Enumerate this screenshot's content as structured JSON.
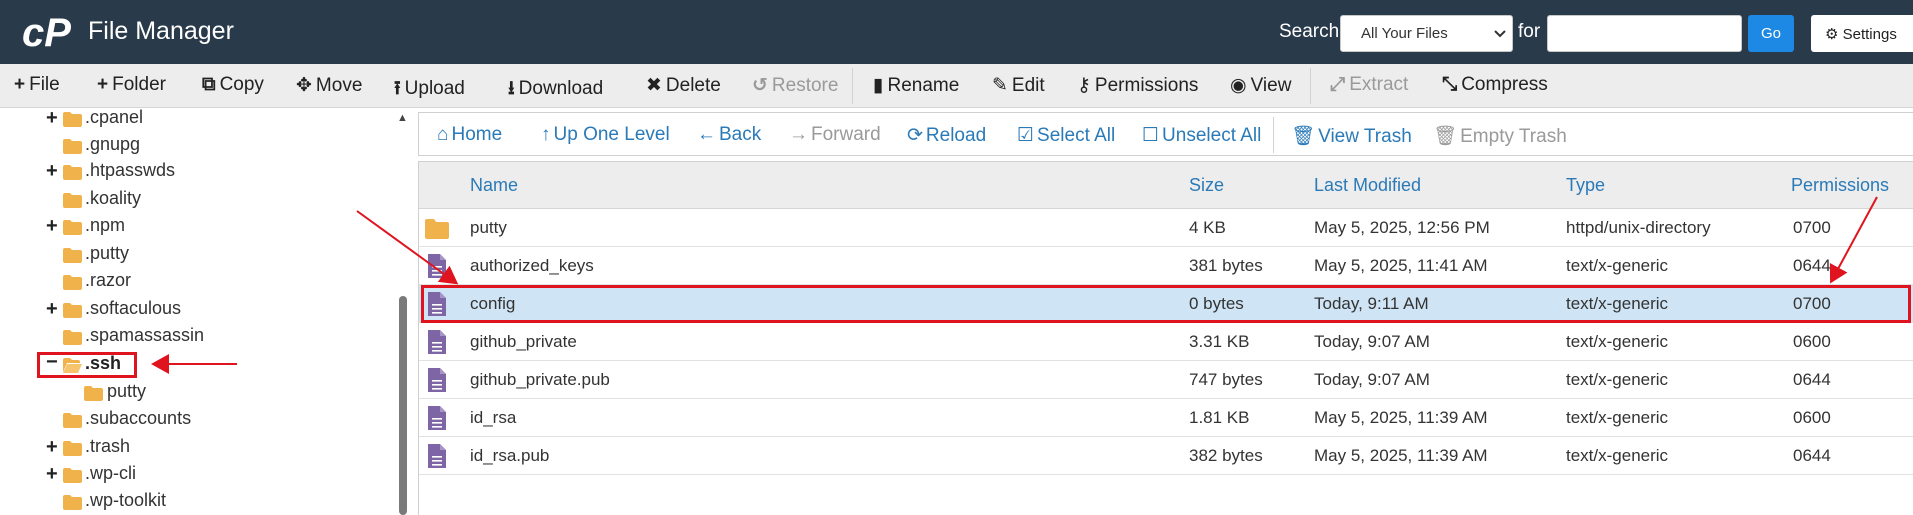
{
  "header": {
    "app_title": "File Manager",
    "search_label": "Search",
    "search_scope": "All Your Files",
    "for_label": "for",
    "search_value": "",
    "go_label": "Go",
    "settings_label": "Settings"
  },
  "toolbar": {
    "items": [
      {
        "label": "File",
        "icon": "plus-icon"
      },
      {
        "label": "Folder",
        "icon": "plus-icon"
      },
      {
        "label": "Copy",
        "icon": "copy-icon"
      },
      {
        "label": "Move",
        "icon": "move-icon"
      },
      {
        "label": "Upload",
        "icon": "upload-icon"
      },
      {
        "label": "Download",
        "icon": "download-icon"
      },
      {
        "label": "Delete",
        "icon": "close-icon"
      },
      {
        "label": "Restore",
        "icon": "undo-icon",
        "disabled": true
      },
      {
        "label": "Rename",
        "icon": "file-icon"
      },
      {
        "label": "Edit",
        "icon": "pencil-icon"
      },
      {
        "label": "Permissions",
        "icon": "key-icon"
      },
      {
        "label": "View",
        "icon": "eye-icon"
      },
      {
        "label": "Extract",
        "icon": "expand-icon",
        "disabled": true
      },
      {
        "label": "Compress",
        "icon": "compress-icon"
      }
    ]
  },
  "tree": {
    "items": [
      {
        "label": ".cpanel",
        "expandable": true
      },
      {
        "label": ".gnupg",
        "expandable": false
      },
      {
        "label": ".htpasswds",
        "expandable": true
      },
      {
        "label": ".koality",
        "expandable": false
      },
      {
        "label": ".npm",
        "expandable": true
      },
      {
        "label": ".putty",
        "expandable": false
      },
      {
        "label": ".razor",
        "expandable": false
      },
      {
        "label": ".softaculous",
        "expandable": true
      },
      {
        "label": ".spamassassin",
        "expandable": false
      },
      {
        "label": ".ssh",
        "expandable": true,
        "expanded": true,
        "selected": true
      },
      {
        "label": "putty",
        "expandable": false,
        "child": true
      },
      {
        "label": ".subaccounts",
        "expandable": false
      },
      {
        "label": ".trash",
        "expandable": true
      },
      {
        "label": ".wp-cli",
        "expandable": true
      },
      {
        "label": ".wp-toolkit",
        "expandable": false
      }
    ]
  },
  "nav": {
    "items": [
      {
        "label": "Home",
        "icon": "home-icon"
      },
      {
        "label": "Up One Level",
        "icon": "arrow-up-icon"
      },
      {
        "label": "Back",
        "icon": "arrow-left-icon"
      },
      {
        "label": "Forward",
        "icon": "arrow-right-icon",
        "disabled": true
      },
      {
        "label": "Reload",
        "icon": "reload-icon"
      },
      {
        "label": "Select All",
        "icon": "checkbox-checked-icon"
      },
      {
        "label": "Unselect All",
        "icon": "checkbox-empty-icon"
      },
      {
        "label": "View Trash",
        "icon": "trash-icon"
      },
      {
        "label": "Empty Trash",
        "icon": "trash-icon",
        "disabled": true
      }
    ]
  },
  "table": {
    "columns": [
      "Name",
      "Size",
      "Last Modified",
      "Type",
      "Permissions"
    ],
    "rows": [
      {
        "name": "putty",
        "size": "4 KB",
        "modified": "May 5, 2025, 12:56 PM",
        "type": "httpd/unix-directory",
        "perms": "0700",
        "kind": "folder"
      },
      {
        "name": "authorized_keys",
        "size": "381 bytes",
        "modified": "May 5, 2025, 11:41 AM",
        "type": "text/x-generic",
        "perms": "0644",
        "kind": "file"
      },
      {
        "name": "config",
        "size": "0 bytes",
        "modified": "Today, 9:11 AM",
        "type": "text/x-generic",
        "perms": "0700",
        "kind": "file",
        "selected": true
      },
      {
        "name": "github_private",
        "size": "3.31 KB",
        "modified": "Today, 9:07 AM",
        "type": "text/x-generic",
        "perms": "0600",
        "kind": "file"
      },
      {
        "name": "github_private.pub",
        "size": "747 bytes",
        "modified": "Today, 9:07 AM",
        "type": "text/x-generic",
        "perms": "0644",
        "kind": "file"
      },
      {
        "name": "id_rsa",
        "size": "1.81 KB",
        "modified": "May 5, 2025, 11:39 AM",
        "type": "text/x-generic",
        "perms": "0600",
        "kind": "file"
      },
      {
        "name": "id_rsa.pub",
        "size": "382 bytes",
        "modified": "May 5, 2025, 11:39 AM",
        "type": "text/x-generic",
        "perms": "0644",
        "kind": "file"
      }
    ]
  },
  "colors": {
    "header_bg": "#293a4a",
    "link_blue": "#2a7ab8",
    "folder": "#f0b24a",
    "file": "#7e66a6",
    "selected_row": "#cfe4f4",
    "annotation_red": "#e0141e"
  }
}
